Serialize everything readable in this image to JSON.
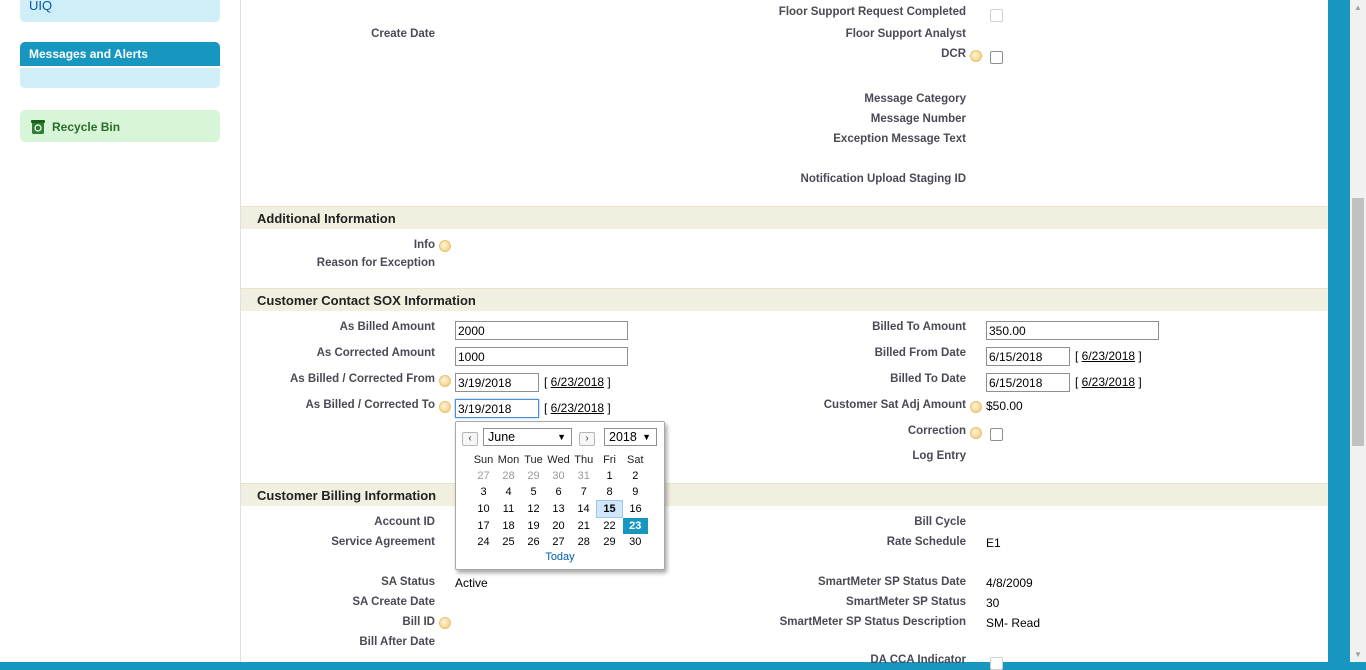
{
  "sidebar": {
    "uiq_label": "UIQ",
    "messages_header": "Messages and Alerts",
    "recycle_bin": "Recycle Bin"
  },
  "top_fields": {
    "create_date_label": "Create Date",
    "floor_support_completed_label": "Floor Support Request Completed",
    "floor_support_analyst_label": "Floor Support Analyst",
    "dcr_label": "DCR",
    "message_category_label": "Message Category",
    "message_number_label": "Message Number",
    "exception_message_text_label": "Exception Message Text",
    "notification_upload_label": "Notification Upload Staging ID"
  },
  "additional": {
    "title": "Additional Information",
    "info_label": "Info",
    "reason_label": "Reason for Exception"
  },
  "sox": {
    "title": "Customer Contact SOX Information",
    "as_billed_amount_label": "As Billed Amount",
    "as_billed_amount_value": "2000",
    "as_corrected_amount_label": "As Corrected Amount",
    "as_corrected_amount_value": "1000",
    "corrected_from_label": "As Billed / Corrected From",
    "corrected_from_value": "3/19/2018",
    "corrected_from_link": "6/23/2018",
    "corrected_to_label": "As Billed / Corrected To",
    "corrected_to_value": "3/19/2018",
    "corrected_to_link": "6/23/2018",
    "billed_to_amount_label": "Billed To Amount",
    "billed_to_amount_value": "350.00",
    "billed_from_date_label": "Billed From Date",
    "billed_from_date_value": "6/15/2018",
    "billed_from_date_link": "6/23/2018",
    "billed_to_date_label": "Billed To Date",
    "billed_to_date_value": "6/15/2018",
    "billed_to_date_link": "6/23/2018",
    "sat_adj_label": "Customer Sat Adj Amount",
    "sat_adj_value": "$50.00",
    "correction_label": "Correction",
    "log_entry_label": "Log Entry"
  },
  "billing": {
    "title": "Customer Billing Information",
    "account_id_label": "Account ID",
    "service_agreement_label": "Service Agreement",
    "sa_status_label": "SA Status",
    "sa_status_value": "Active",
    "sa_create_date_label": "SA Create Date",
    "bill_id_label": "Bill ID",
    "bill_after_date_label": "Bill After Date",
    "bill_cycle_label": "Bill Cycle",
    "rate_schedule_label": "Rate Schedule",
    "rate_schedule_value": "E1",
    "sm_status_date_label": "SmartMeter SP Status Date",
    "sm_status_date_value": "4/8/2009",
    "sm_status_label": "SmartMeter SP Status",
    "sm_status_value": "30",
    "sm_status_desc_label": "SmartMeter SP Status Description",
    "sm_status_desc_value": "SM- Read",
    "da_cca_label": "DA CCA Indicator"
  },
  "calendar": {
    "month": "June",
    "year": "2018",
    "weekdays": [
      "Sun",
      "Mon",
      "Tue",
      "Wed",
      "Thu",
      "Fri",
      "Sat"
    ],
    "weeks": [
      [
        "27",
        "28",
        "29",
        "30",
        "31",
        "1",
        "2"
      ],
      [
        "3",
        "4",
        "5",
        "6",
        "7",
        "8",
        "9"
      ],
      [
        "10",
        "11",
        "12",
        "13",
        "14",
        "15",
        "16"
      ],
      [
        "17",
        "18",
        "19",
        "20",
        "21",
        "22",
        "23"
      ],
      [
        "24",
        "25",
        "26",
        "27",
        "28",
        "29",
        "30"
      ]
    ],
    "today_day": "15",
    "selected_day": "23",
    "today_link": "Today"
  },
  "colors": {
    "brand": "#1797c0",
    "section_bg": "#f1efdf",
    "label": "#4a4a56"
  }
}
